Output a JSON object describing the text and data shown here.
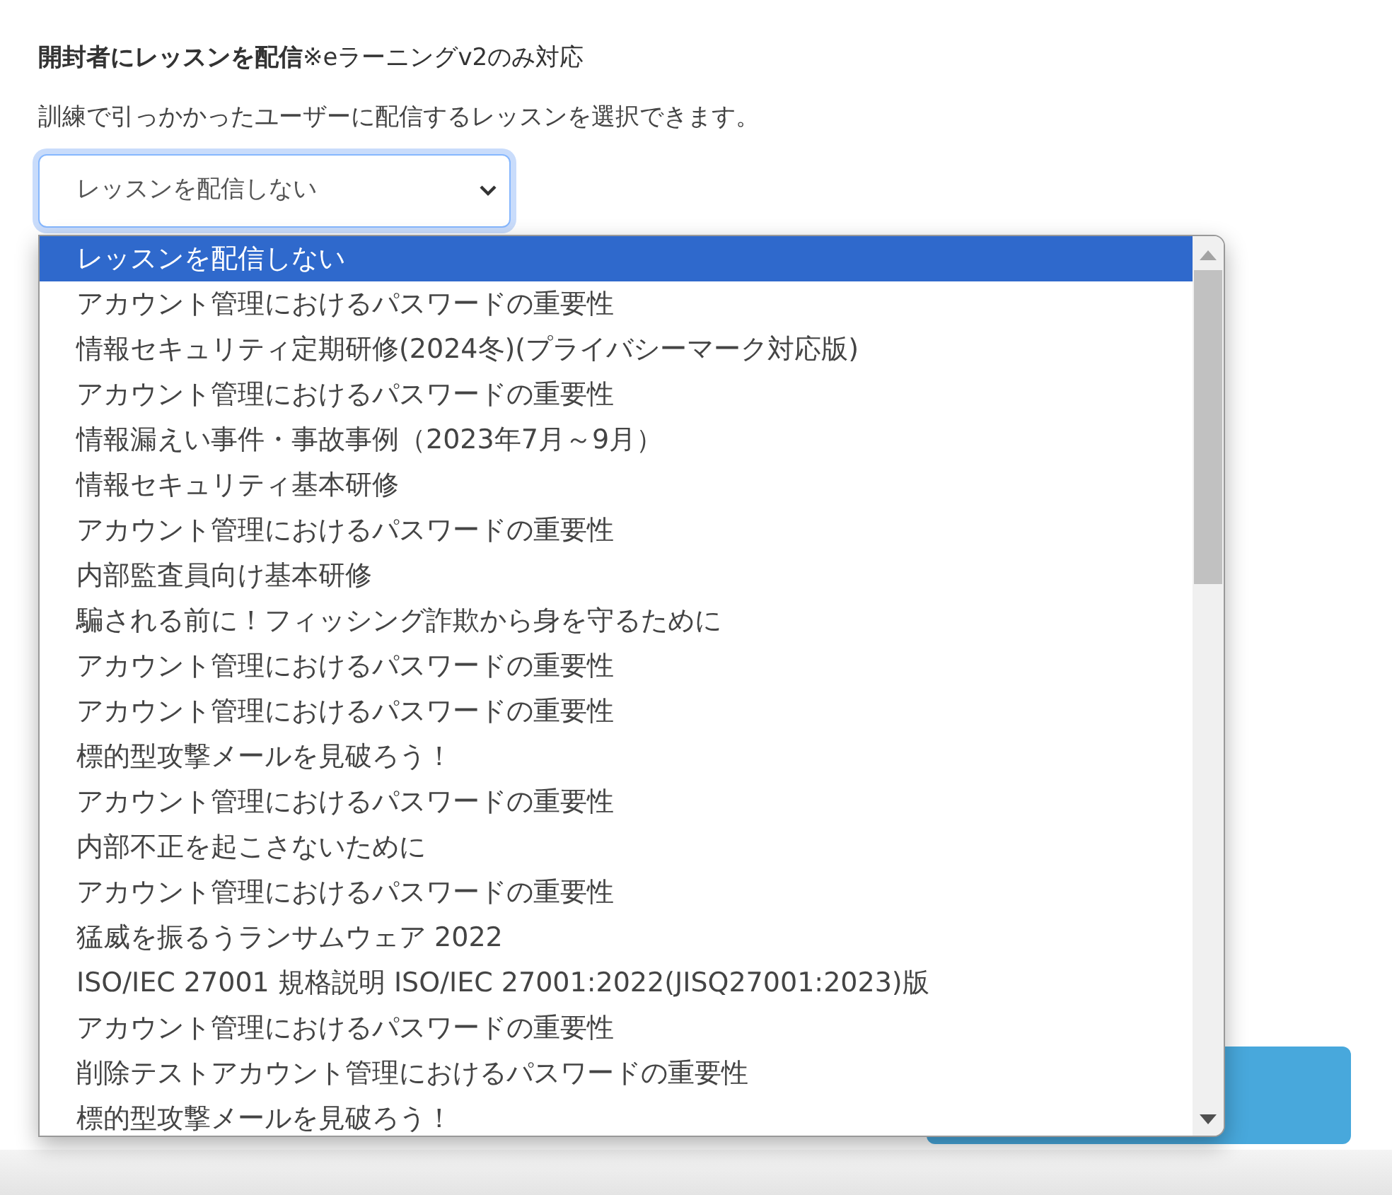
{
  "heading": "**開封者にレッスンを配信**※eラーニングv2のみ対応",
  "description": "訓練で引っかかったユーザーに配信するレッスンを選択できます。",
  "select": {
    "value": "レッスンを配信しない",
    "expanded": true
  },
  "options": [
    {
      "label": "レッスンを配信しない",
      "selected": true
    },
    {
      "label": "アカウント管理におけるパスワードの重要性",
      "selected": false
    },
    {
      "label": "情報セキュリティ定期研修(2024冬)(プライバシーマーク対応版)",
      "selected": false
    },
    {
      "label": "アカウント管理におけるパスワードの重要性",
      "selected": false
    },
    {
      "label": "情報漏えい事件・事故事例（2023年7月～9月）",
      "selected": false
    },
    {
      "label": "情報セキュリティ基本研修",
      "selected": false
    },
    {
      "label": "アカウント管理におけるパスワードの重要性",
      "selected": false
    },
    {
      "label": "内部監査員向け基本研修",
      "selected": false
    },
    {
      "label": "騙される前に！フィッシング詐欺から身を守るために",
      "selected": false
    },
    {
      "label": "アカウント管理におけるパスワードの重要性",
      "selected": false
    },
    {
      "label": "アカウント管理におけるパスワードの重要性",
      "selected": false
    },
    {
      "label": "標的型攻撃メールを見破ろう！",
      "selected": false
    },
    {
      "label": "アカウント管理におけるパスワードの重要性",
      "selected": false
    },
    {
      "label": "内部不正を起こさないために",
      "selected": false
    },
    {
      "label": "アカウント管理におけるパスワードの重要性",
      "selected": false
    },
    {
      "label": "猛威を振るうランサムウェア 2022",
      "selected": false
    },
    {
      "label": "ISO/IEC 27001 規格説明 ISO/IEC 27001:2022(JISQ27001:2023)版",
      "selected": false
    },
    {
      "label": "アカウント管理におけるパスワードの重要性",
      "selected": false
    },
    {
      "label": "削除テストアカウント管理におけるパスワードの重要性",
      "selected": false
    },
    {
      "label": "標的型攻撃メールを見破ろう！",
      "selected": false
    }
  ]
}
